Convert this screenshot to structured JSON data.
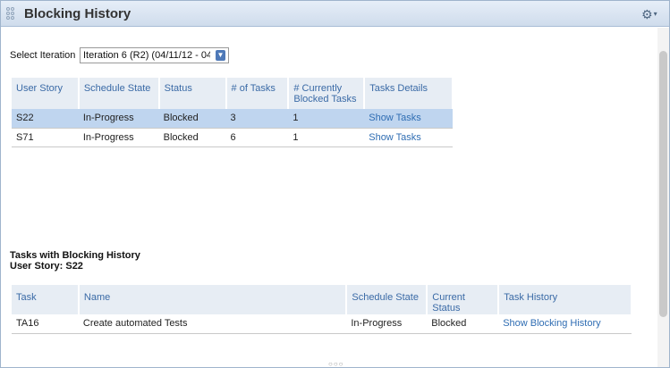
{
  "panel": {
    "title": "Blocking History"
  },
  "iteration": {
    "label": "Select Iteration",
    "selected": "Iteration 6 (R2) (04/11/12 - 04"
  },
  "stories_table": {
    "headers": [
      "User Story",
      "Schedule State",
      "Status",
      "# of Tasks",
      "# Currently Blocked Tasks",
      "Tasks Details"
    ],
    "rows": [
      {
        "story": "S22",
        "schedule": "In-Progress",
        "status": "Blocked",
        "tasks": "3",
        "blocked": "1",
        "details": "Show Tasks",
        "selected": true
      },
      {
        "story": "S71",
        "schedule": "In-Progress",
        "status": "Blocked",
        "tasks": "6",
        "blocked": "1",
        "details": "Show Tasks",
        "selected": false
      }
    ]
  },
  "tasks_section": {
    "heading": "Tasks with Blocking History",
    "story_label": "User Story: S22"
  },
  "tasks_table": {
    "headers": [
      "Task",
      "Name",
      "Schedule State",
      "Current Status",
      "Task History"
    ],
    "rows": [
      {
        "task": "TA16",
        "name": "Create automated Tests",
        "schedule": "In-Progress",
        "status": "Blocked",
        "history": "Show Blocking History"
      }
    ]
  },
  "icons": {
    "grip": "drag-grip-icon",
    "gear": "gear-icon",
    "dropdown": "dropdown-arrow-icon",
    "resize": "resize-handle-icon"
  }
}
